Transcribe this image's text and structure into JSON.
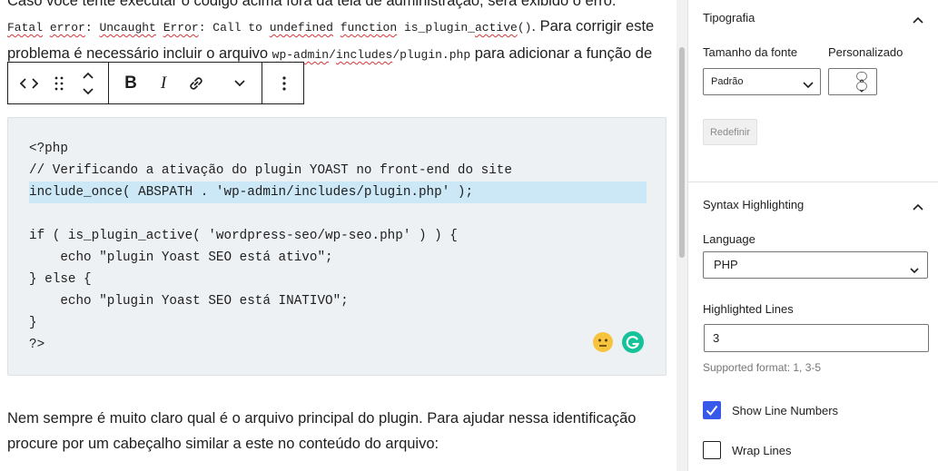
{
  "editor": {
    "para_top": {
      "line0": "Caso você tente executar o código acima fora da tela de administração, será exibido o erro:",
      "line1_parts": [
        "Fatal",
        " ",
        "error",
        ": ",
        "Uncaught",
        " ",
        "Error",
        ": Call to ",
        "undefined",
        " ",
        "function",
        " is_plugin_",
        "active",
        "()",
        ". Para corrigir este"
      ],
      "line2_a": "problema é necessário incluir o arquivo ",
      "line2_code_parts": [
        "wp-admin",
        "/",
        "includes",
        "/plugin.php"
      ],
      "line2_b": " para adicionar a função de"
    },
    "toolbar": {
      "code_icon": "code-icon",
      "drag_icon": "drag-handle-icon",
      "move_icon": "move-up-down-icon",
      "bold_label": "B",
      "italic_label": "I",
      "link_icon": "link-icon",
      "more_rich_icon": "chevron-down-icon",
      "options_icon": "more-vertical-icon"
    },
    "code": {
      "lines": [
        "<?php",
        "// Verificando a ativação do plugin YOAST no front-end do site",
        "include_once( ABSPATH . 'wp-admin/includes/plugin.php' );",
        "",
        "if ( is_plugin_active( 'wordpress-seo/wp-seo.php' ) ) {",
        "    echo \"plugin Yoast SEO está ativo\";",
        "} else {",
        "    echo \"plugin Yoast SEO está INATIVO\";",
        "}",
        "?>"
      ],
      "highlighted_line": 3
    },
    "para_bottom": {
      "line1": "Nem sempre é muito claro qual é o arquivo principal do plugin. Para ajudar nessa identificação",
      "line2": "procure por um cabeçalho similar a este no conteúdo do arquivo:"
    }
  },
  "sidebar": {
    "typography": {
      "title": "Tipografia",
      "font_size_label": "Tamanho da fonte",
      "custom_label": "Personalizado",
      "font_size_value": "Padrão",
      "custom_value": "",
      "reset_label": "Redefinir"
    },
    "syntax": {
      "title": "Syntax Highlighting",
      "language_label": "Language",
      "language_value": "PHP",
      "lines_label": "Highlighted Lines",
      "lines_value": "3",
      "supported_format": "Supported format: 1, 3-5",
      "show_line_numbers_label": "Show Line Numbers",
      "show_line_numbers_checked": true,
      "wrap_lines_label": "Wrap Lines",
      "wrap_lines_checked": false
    }
  },
  "colors": {
    "accent": "#3858e9",
    "code_bg": "#eef1f4",
    "highlight_bg": "#cce7f6",
    "error_underline": "#d63638"
  }
}
